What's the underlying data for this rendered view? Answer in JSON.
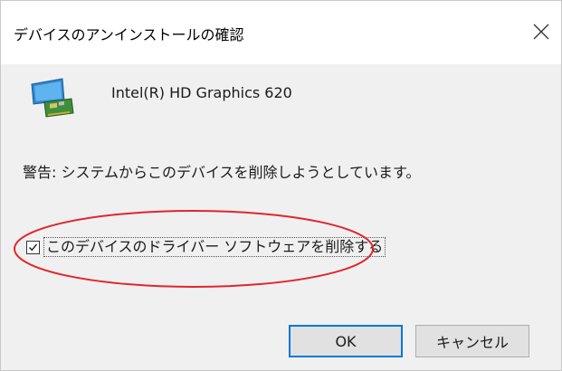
{
  "window": {
    "title": "デバイスのアンインストールの確認"
  },
  "device": {
    "name": "Intel(R) HD Graphics 620",
    "icon": "display-adapter-icon"
  },
  "warning_text": "警告: システムからこのデバイスを削除しようとしています。",
  "delete_driver_checkbox": {
    "label": "このデバイスのドライバー ソフトウェアを削除する",
    "checked": true
  },
  "buttons": {
    "ok": "OK",
    "cancel": "キャンセル"
  },
  "colors": {
    "annotation": "#e0262b",
    "focus_border": "#0078d7"
  }
}
